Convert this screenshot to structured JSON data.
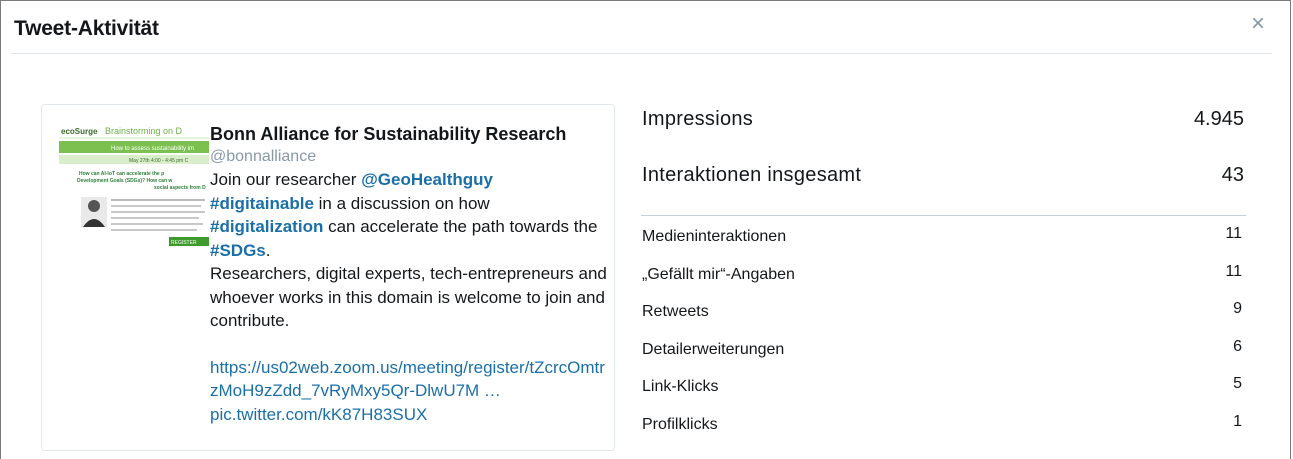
{
  "modal": {
    "title": "Tweet-Aktivität",
    "close_icon": "×"
  },
  "tweet": {
    "author_name": "Bonn Alliance for Sustainability Research",
    "handle": "@bonnalliance",
    "text": {
      "t1": "Join our researcher ",
      "mention": "@GeoHealthguy",
      "hashtag1": "#digitainable",
      "t2": " in a discussion on how",
      "hashtag2": "#digitalization",
      "t3": " can accelerate the path towards the ",
      "hashtag3": "#SDGs",
      "t4": ".",
      "t5": "Researchers, digital experts, tech-entrepreneurs and whoever works in this domain is welcome to join and contribute.",
      "link1": "https://us02web.zoom.us/meeting/register/tZcrcOmtrzMoH9zZdd_7vRyMxy5Qr-DlwU7M …",
      "link2": "pic.twitter.com/kK87H83SUX"
    },
    "thumbnail": {
      "brand": "ecoSurge",
      "heading": "Brainstorming on D",
      "banner": "How to assess sustainability im",
      "date": "May 27th 4:00 - 4:45 pm C",
      "q1": "How can AI-IoT can accelerate the p",
      "q2": "Development Goals (SDGs)? How can w",
      "q3": "social aspects from D",
      "button": "REGISTER"
    }
  },
  "stats": {
    "impressions": {
      "label": "Impressions",
      "value": "4.945"
    },
    "interactions": {
      "label": "Interaktionen insgesamt",
      "value": "43"
    },
    "items": [
      {
        "label": "Medieninteraktionen",
        "value": "11"
      },
      {
        "label": "„Gefällt mir“-Angaben",
        "value": "11"
      },
      {
        "label": "Retweets",
        "value": "9"
      },
      {
        "label": "Detailerweiterungen",
        "value": "6"
      },
      {
        "label": "Link-Klicks",
        "value": "5"
      },
      {
        "label": "Profilklicks",
        "value": "1"
      }
    ]
  }
}
